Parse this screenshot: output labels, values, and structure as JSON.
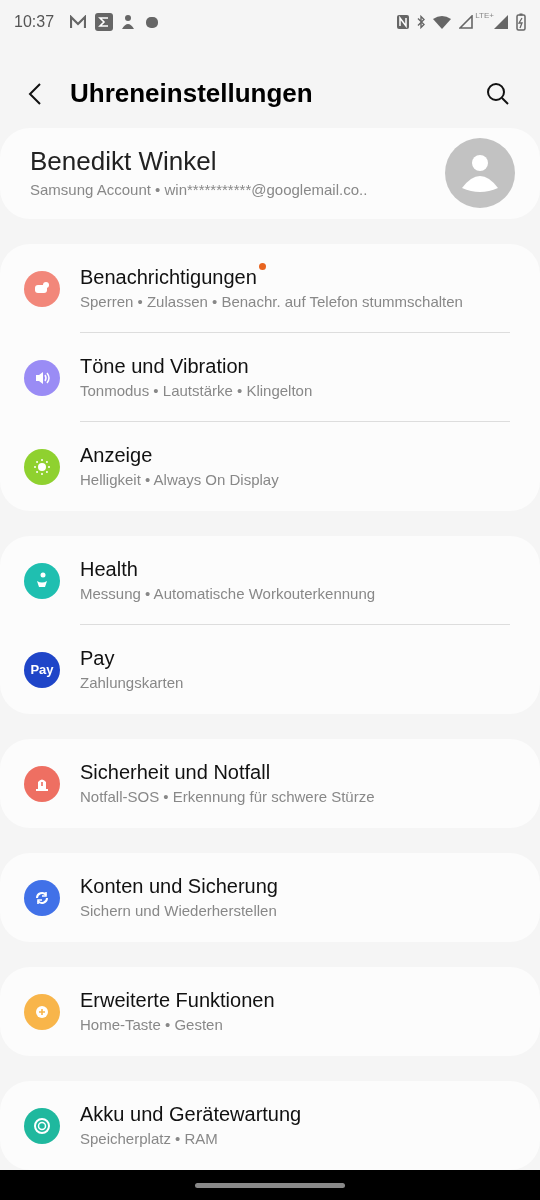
{
  "status_bar": {
    "time": "10:37",
    "network": "LTE+"
  },
  "header": {
    "title": "Uhreneinstellungen"
  },
  "account": {
    "name": "Benedikt Winkel",
    "detail": "Samsung Account • win***********@googlemail.co.."
  },
  "groups": [
    {
      "items": [
        {
          "title": "Benachrichtigungen",
          "subtitle": "Sperren • Zulassen • Benachr. auf Telefon stummschalten",
          "color": "#f2877a",
          "new_dot": true
        },
        {
          "title": "Töne und Vibration",
          "subtitle": "Tonmodus • Lautstärke • Klingelton",
          "color": "#9a8cf5",
          "new_dot": false
        },
        {
          "title": "Anzeige",
          "subtitle": "Helligkeit • Always On Display",
          "color": "#8fd12f",
          "new_dot": false
        }
      ]
    },
    {
      "items": [
        {
          "title": "Health",
          "subtitle": "Messung • Automatische Workouterkennung",
          "color": "#1fbfb0",
          "new_dot": false
        },
        {
          "title": "Pay",
          "subtitle": "Zahlungskarten",
          "color": "#1f45c8",
          "new_dot": false,
          "icon_text": "Pay"
        }
      ]
    },
    {
      "items": [
        {
          "title": "Sicherheit und Notfall",
          "subtitle": "Notfall-SOS • Erkennung für schwere Stürze",
          "color": "#ee6f62",
          "new_dot": false
        }
      ]
    },
    {
      "items": [
        {
          "title": "Konten und Sicherung",
          "subtitle": "Sichern und Wiederherstellen",
          "color": "#4171e8",
          "new_dot": false
        }
      ]
    },
    {
      "items": [
        {
          "title": "Erweiterte Funktionen",
          "subtitle": "Home-Taste • Gesten",
          "color": "#f8b54a",
          "new_dot": false
        }
      ]
    },
    {
      "items": [
        {
          "title": "Akku und Gerätewartung",
          "subtitle": "Speicherplatz • RAM",
          "color": "#1fb89e",
          "new_dot": false
        }
      ]
    }
  ]
}
